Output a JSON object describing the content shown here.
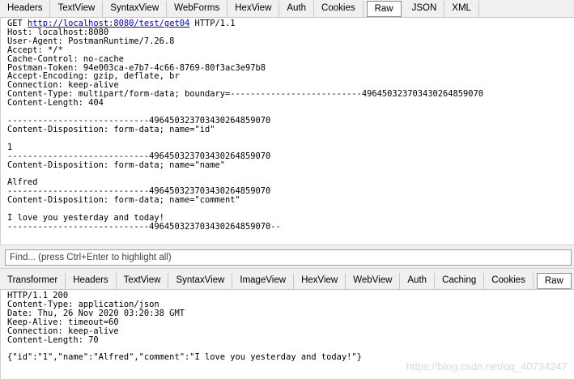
{
  "request_tabs": [
    "Headers",
    "TextView",
    "SyntaxView",
    "WebForms",
    "HexView",
    "Auth",
    "Cookies",
    "Raw",
    "JSON",
    "XML"
  ],
  "request_active_tab": "Raw",
  "request": {
    "method": "GET ",
    "url": "http://localhost:8080/test/get04",
    "protocol": " HTTP/1.1",
    "body": "Host: localhost:8080\nUser-Agent: PostmanRuntime/7.26.8\nAccept: */*\nCache-Control: no-cache\nPostman-Token: 94e003ca-e7b7-4c66-8769-80f3ac3e97b8\nAccept-Encoding: gzip, deflate, br\nConnection: keep-alive\nContent-Type: multipart/form-data; boundary=--------------------------496450323703430264859070\nContent-Length: 404\n\n----------------------------496450323703430264859070\nContent-Disposition: form-data; name=\"id\"\n\n1\n----------------------------496450323703430264859070\nContent-Disposition: form-data; name=\"name\"\n\nAlfred\n----------------------------496450323703430264859070\nContent-Disposition: form-data; name=\"comment\"\n\nI love you yesterday and today!\n----------------------------496450323703430264859070--"
  },
  "find_placeholder": "Find... (press Ctrl+Enter to highlight all)",
  "response_tabs": [
    "Transformer",
    "Headers",
    "TextView",
    "SyntaxView",
    "ImageView",
    "HexView",
    "WebView",
    "Auth",
    "Caching",
    "Cookies",
    "Raw"
  ],
  "response_active_tab": "Raw",
  "response": {
    "body": "HTTP/1.1 200\nContent-Type: application/json\nDate: Thu, 26 Nov 2020 03:20:38 GMT\nKeep-Alive: timeout=60\nConnection: keep-alive\nContent-Length: 70\n\n{\"id\":\"1\",\"name\":\"Alfred\",\"comment\":\"I love you yesterday and today!\"}"
  },
  "watermark": "https://blog.csdn.net/qq_40734247"
}
